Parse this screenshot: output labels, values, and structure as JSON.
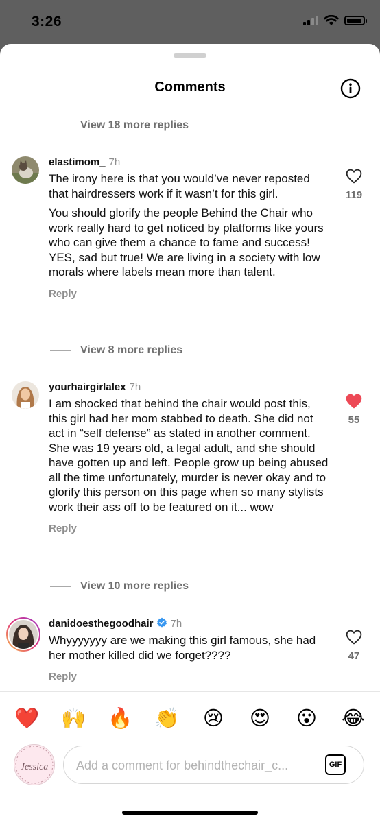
{
  "status_bar": {
    "time": "3:26"
  },
  "header": {
    "title": "Comments"
  },
  "reply_toggles": [
    "View 18 more replies",
    "View 8 more replies",
    "View 10 more replies"
  ],
  "comments": [
    {
      "username": "elastimom_",
      "time": "7h",
      "paragraphs": [
        "The irony here is that you would’ve never reposted that hairdressers work if it wasn’t for this girl.",
        "You should glorify the people Behind the Chair who work really hard to get noticed by platforms like yours who can give them a chance to fame and success! YES, sad but true! We are living in a society with low morals where labels mean more than talent."
      ],
      "reply_label": "Reply",
      "likes": "119",
      "liked": false
    },
    {
      "username": "yourhairgirlalex",
      "time": "7h",
      "paragraphs": [
        "I am shocked that behind the chair would post this, this girl had her mom stabbed to death. She did not act in “self defense” as stated in another comment. She was 19 years old, a legal adult, and she should have gotten up and left. People grow up being abused all the time unfortunately, murder is never okay and to glorify this person on this page when so many stylists work their ass off to be featured on it... wow"
      ],
      "reply_label": "Reply",
      "likes": "55",
      "liked": true
    },
    {
      "username": "danidoesthegoodhair",
      "time": "7h",
      "verified": true,
      "paragraphs": [
        "Whyyyyyyy are we making this girl famous, she had her mother killed did we forget????"
      ],
      "reply_label": "Reply",
      "likes": "47",
      "liked": false
    }
  ],
  "emoji_bar": [
    "❤️",
    "🙌",
    "🔥",
    "👏",
    "😢",
    "😍",
    "😮",
    "😂"
  ],
  "composer": {
    "placeholder": "Add a comment for behindthechair_c...",
    "gif_label": "GIF",
    "avatar_name": "Jessica"
  },
  "colors": {
    "like_active": "#ed4956",
    "muted_text": "#8e8e8e",
    "verified": "#3897f0"
  }
}
